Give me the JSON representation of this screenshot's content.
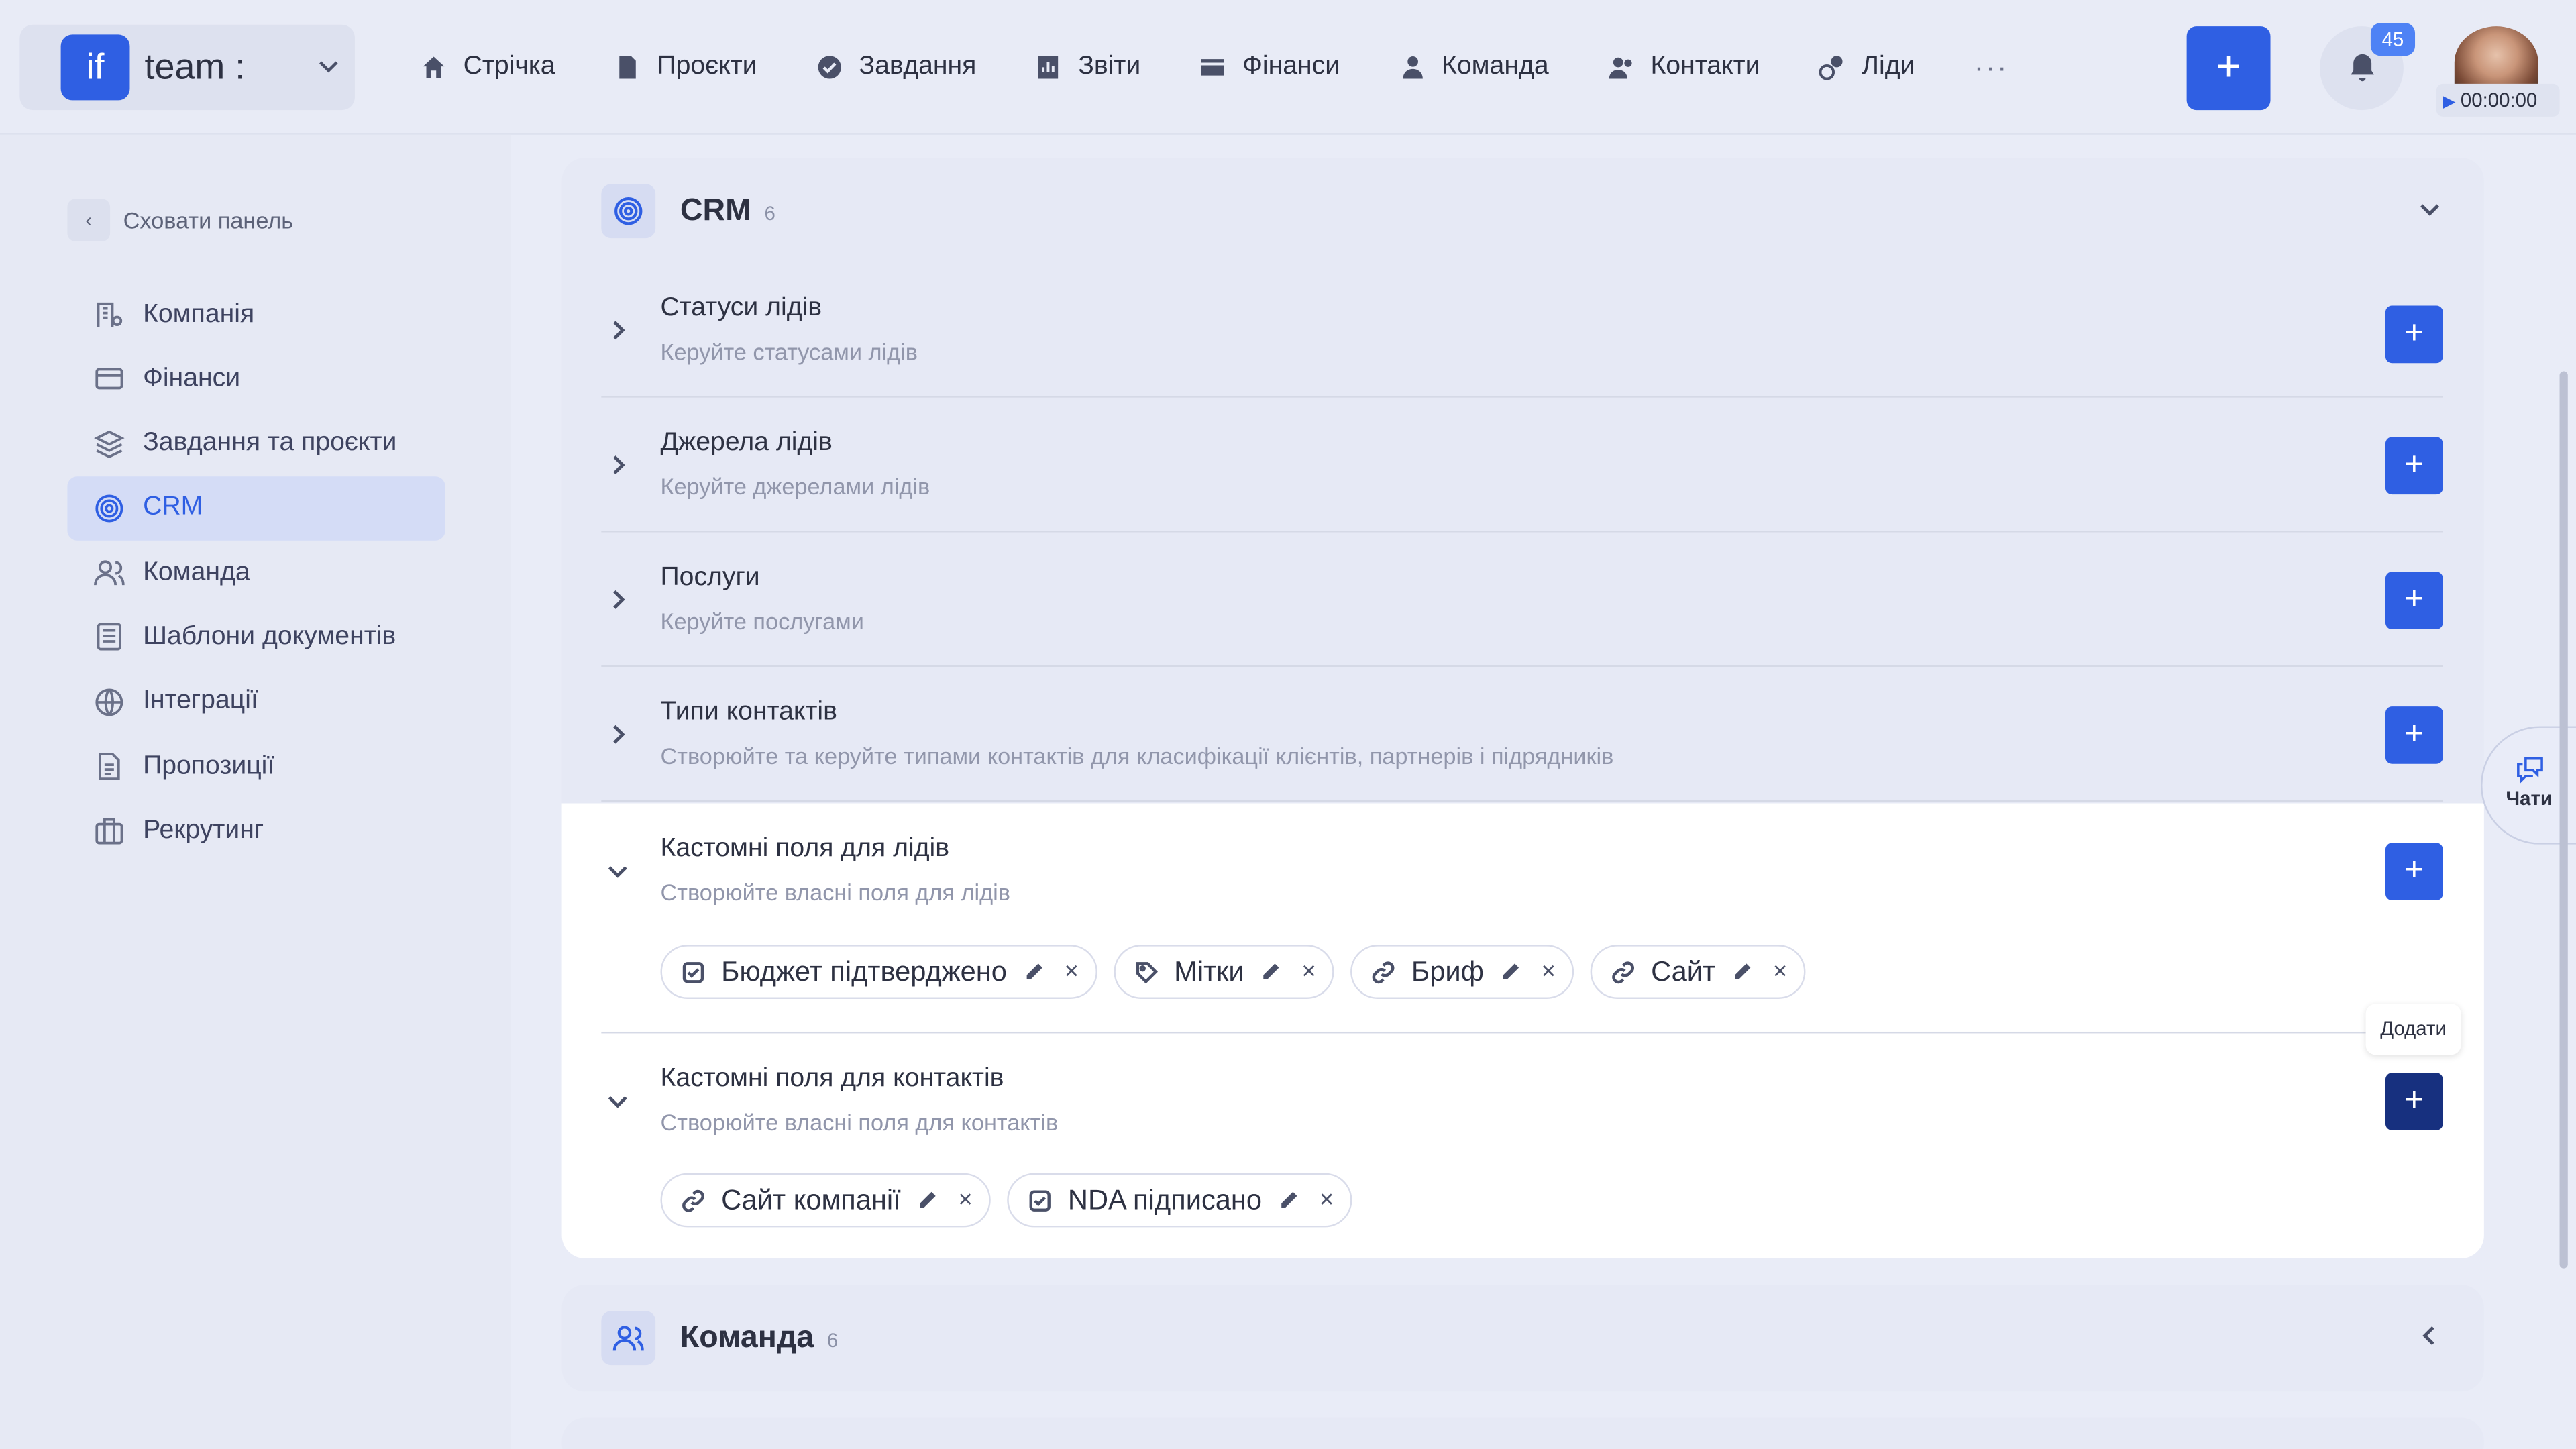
{
  "brand": {
    "logo": "if",
    "name": "team :"
  },
  "nav": [
    {
      "label": "Стрічка",
      "icon": "home-icon"
    },
    {
      "label": "Проєкти",
      "icon": "document-icon"
    },
    {
      "label": "Завдання",
      "icon": "check-circle-icon"
    },
    {
      "label": "Звіти",
      "icon": "report-icon"
    },
    {
      "label": "Фінанси",
      "icon": "wallet-icon"
    },
    {
      "label": "Команда",
      "icon": "user-icon"
    },
    {
      "label": "Контакти",
      "icon": "contacts-icon"
    },
    {
      "label": "Ліди",
      "icon": "leads-icon"
    }
  ],
  "nav_more": "···",
  "header": {
    "add_label": "+",
    "notifications_count": "45",
    "timer": "00:00:00"
  },
  "sidebar": {
    "hide_label": "Сховати панель",
    "items": [
      {
        "label": "Компанія",
        "icon": "company-icon"
      },
      {
        "label": "Фінанси",
        "icon": "card-icon"
      },
      {
        "label": "Завдання та проєкти",
        "icon": "layers-icon"
      },
      {
        "label": "CRM",
        "icon": "target-icon",
        "active": true
      },
      {
        "label": "Команда",
        "icon": "team-icon"
      },
      {
        "label": "Шаблони документів",
        "icon": "template-icon"
      },
      {
        "label": "Інтеграції",
        "icon": "globe-icon"
      },
      {
        "label": "Пропозиції",
        "icon": "proposal-icon"
      },
      {
        "label": "Рекрутинг",
        "icon": "briefcase-icon"
      }
    ]
  },
  "crm": {
    "title": "CRM",
    "count": "6",
    "rows": [
      {
        "title": "Статуси лідів",
        "subtitle": "Керуйте статусами лідів"
      },
      {
        "title": "Джерела лідів",
        "subtitle": "Керуйте джерелами лідів"
      },
      {
        "title": "Послуги",
        "subtitle": "Керуйте послугами"
      },
      {
        "title": "Типи контактів",
        "subtitle": "Створюйте та керуйте типами контактів для класифікації клієнтів, партнерів і підрядників"
      },
      {
        "title": "Кастомні поля для лідів",
        "subtitle": "Створюйте власні поля для лідів"
      },
      {
        "title": "Кастомні поля для контактів",
        "subtitle": "Створюйте власні поля для контактів"
      }
    ],
    "lead_fields": [
      {
        "label": "Бюджет підтверджено",
        "icon": "checkbox-icon"
      },
      {
        "label": "Мітки",
        "icon": "tag-icon"
      },
      {
        "label": "Бриф",
        "icon": "link-icon"
      },
      {
        "label": "Сайт",
        "icon": "link-icon"
      }
    ],
    "contact_fields": [
      {
        "label": "Сайт компанії",
        "icon": "link-icon"
      },
      {
        "label": "NDA підписано",
        "icon": "checkbox-icon"
      }
    ],
    "plus_label": "+",
    "remove_label": "×"
  },
  "tooltip": "Додати",
  "team_card": {
    "title": "Команда",
    "count": "6"
  },
  "chats": {
    "label": "Чати"
  },
  "colors": {
    "accent": "#2f5fe3",
    "accent_dark": "#17307f",
    "background": "#e9ecf7"
  }
}
